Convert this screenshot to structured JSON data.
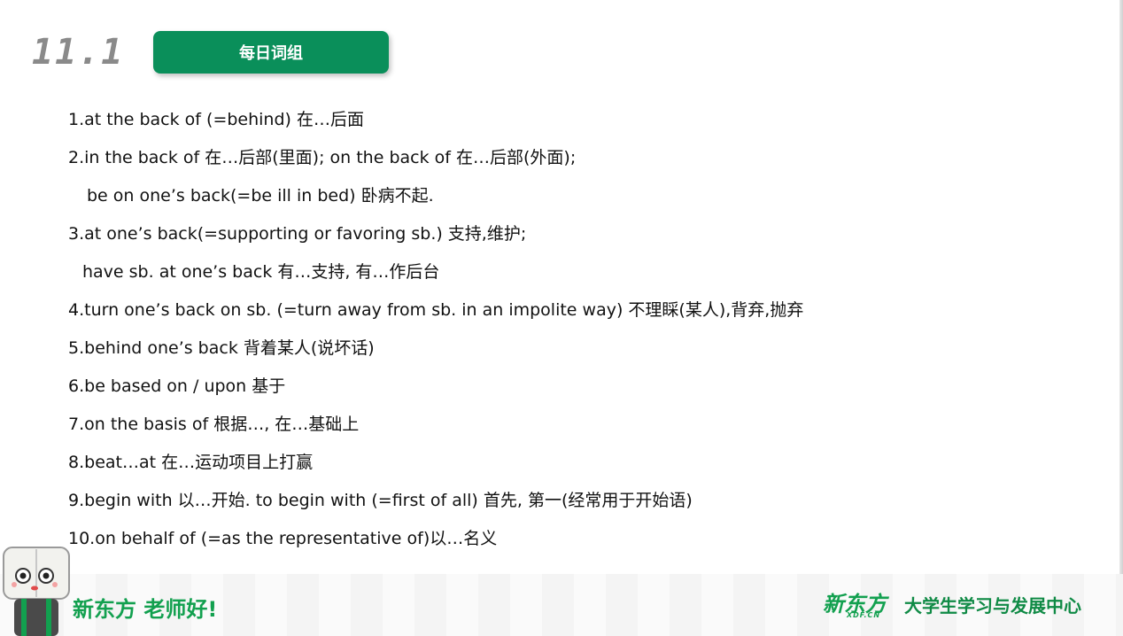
{
  "header": {
    "date": "11.1",
    "title": "每日词组"
  },
  "lines": [
    "1.at the back of (=behind) 在…后面",
    "2.in the back of 在…后部(里面); on the back of 在…后部(外面);",
    "be on one’s back(=be ill in bed) 卧病不起.",
    "3.at one’s back(=supporting or favoring sb.) 支持,维护;",
    "have sb. at one’s back 有…支持, 有…作后台",
    "4.turn one’s back on sb. (=turn away from sb. in an impolite way) 不理睬(某人),背弃,抛弃",
    "5.behind one’s back 背着某人(说坏话)",
    "6.be based on / upon 基于",
    "7.on the basis of 根据…, 在…基础上",
    "8.beat…at 在…运动项目上打赢",
    "9.begin with 以…开始. to begin with (=first of all) 首先, 第一(经常用于开始语)",
    "10.on behalf of (=as the representative of)以…名义"
  ],
  "footer": {
    "slogan": "新东方 老师好!",
    "brand": "新东方",
    "brand_sub": "XDF.CN",
    "center": "大学生学习与发展中心"
  },
  "colors": {
    "accent": "#0a8f5a",
    "brand_green": "#12a04f"
  }
}
